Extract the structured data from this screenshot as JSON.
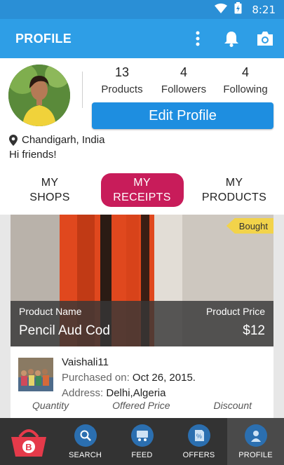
{
  "status_bar": {
    "time": "8:21"
  },
  "app_bar": {
    "title": "PROFILE"
  },
  "profile": {
    "stats": [
      {
        "value": "13",
        "label": "Products"
      },
      {
        "value": "4",
        "label": "Followers"
      },
      {
        "value": "4",
        "label": "Following"
      }
    ],
    "edit_label": "Edit Profile",
    "location": "Chandigarh, India",
    "bio": "Hi friends!"
  },
  "tabs": [
    {
      "line1": "MY",
      "line2": "SHOPS"
    },
    {
      "line1": "MY",
      "line2": "RECEIPTS"
    },
    {
      "line1": "MY",
      "line2": "PRODUCTS"
    }
  ],
  "receipt": {
    "badge": "Bought",
    "product_name_label": "Product Name",
    "product_price_label": "Product Price",
    "product_name": "Pencil Aud Cod",
    "product_price": "$12",
    "seller": "Vaishali11",
    "purchased_label": "Purchased on:",
    "purchased_date": "Oct 26, 2015.",
    "address_label": "Address:",
    "address": "Delhi,Algeria",
    "metric_labels": [
      "Quantity",
      "Offered Price",
      "Discount"
    ]
  },
  "bottom_nav": {
    "items": [
      "SEARCH",
      "FEED",
      "OFFERS",
      "PROFILE"
    ],
    "brand_letter": "B"
  },
  "colors": {
    "app_bar": "#2e9ee6",
    "status_bar": "#2a8fd6",
    "edit_button": "#1e8ee0",
    "active_tab": "#c81c5a",
    "badge": "#f2d34a",
    "bottom_nav": "#333333"
  }
}
